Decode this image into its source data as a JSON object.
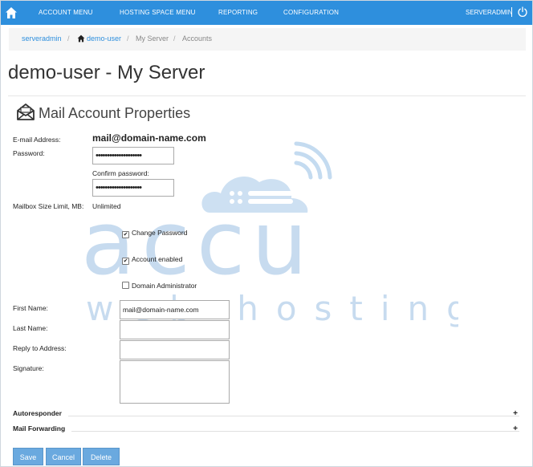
{
  "topnav": {
    "items": [
      "ACCOUNT MENU",
      "HOSTING SPACE MENU",
      "REPORTING",
      "CONFIGURATION"
    ],
    "user": "SERVERADMIN",
    "home_icon": "home-icon",
    "power_icon": "power-icon"
  },
  "breadcrumb": {
    "items": [
      "serveradmin",
      "demo-user",
      "My Server",
      "Accounts"
    ]
  },
  "page": {
    "title": "demo-user - My Server",
    "section_title": "Mail Account Properties",
    "section_icon": "mail-icon"
  },
  "form": {
    "email_label": "E-mail Address:",
    "email_value": "mail@domain-name.com",
    "password_label": "Password:",
    "password_value": "••••••••••••••••••••",
    "confirm_label": "Confirm password:",
    "confirm_value": "••••••••••••••••••••",
    "mailbox_label": "Mailbox Size Limit, MB:",
    "mailbox_value": "Unlimited",
    "change_password": {
      "label": "Change Password",
      "checked": true
    },
    "account_enabled": {
      "label": "Account enabled",
      "checked": true
    },
    "domain_admin": {
      "label": "Domain Administrator",
      "checked": false
    },
    "first_name_label": "First Name:",
    "first_name_value": "mail@domain-name.com",
    "last_name_label": "Last Name:",
    "last_name_value": "",
    "reply_label": "Reply to Address:",
    "reply_value": "",
    "signature_label": "Signature:",
    "signature_value": ""
  },
  "sections": {
    "autoresponder": "Autoresponder",
    "mail_forwarding": "Mail Forwarding",
    "expand": "+"
  },
  "buttons": {
    "save": "Save",
    "cancel": "Cancel",
    "delete": "Delete"
  },
  "watermark": {
    "line1": "accu",
    "line2": "web hosting"
  },
  "colors": {
    "nav": "#2e8fdd",
    "button": "#6aa9df",
    "watermark": "#b5d0ea"
  }
}
